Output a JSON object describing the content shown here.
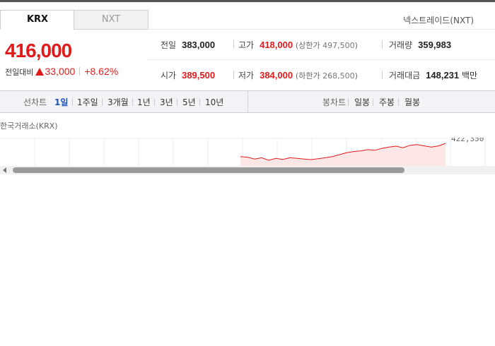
{
  "market_tabs": {
    "active": "KRX",
    "inactive": "NXT"
  },
  "nxt_link": "넥스트레이드(NXT)",
  "quote": {
    "price": "416,000",
    "change_label": "전일대비",
    "change_amount": "33,000",
    "change_percent": "+8.62%",
    "color_up": "#e01b1b"
  },
  "stats": {
    "prev_close": {
      "label": "전일",
      "value": "383,000"
    },
    "high": {
      "label": "고가",
      "value": "418,000",
      "upper_limit_label": "상한가",
      "upper_limit_value": "497,500"
    },
    "volume": {
      "label": "거래량",
      "value": "359,983"
    },
    "open": {
      "label": "시가",
      "value": "389,500"
    },
    "low": {
      "label": "저가",
      "value": "384,000",
      "lower_limit_label": "하한가",
      "lower_limit_value": "268,500"
    },
    "trade_value": {
      "label": "거래대금",
      "value": "148,231",
      "unit": "백만"
    }
  },
  "chart_toolbar": {
    "line_label": "선차트",
    "periods": [
      "1일",
      "1주일",
      "3개월",
      "1년",
      "3년",
      "5년",
      "10년"
    ],
    "active_period": "1일",
    "candle_label": "봉차트",
    "candle_periods": [
      "일봉",
      "주봉",
      "월봉"
    ]
  },
  "exchange_label": "한국거래소(KRX)",
  "chart_data": {
    "type": "line",
    "title": "",
    "xlabel": "",
    "ylabel": "",
    "y_tick_labels": [
      "422,350"
    ],
    "grid": true,
    "series": [
      {
        "values": [
          395000,
          394000,
          391000,
          393000,
          389000,
          392000,
          390500,
          393000,
          392000,
          391000,
          390000,
          391500,
          393000,
          395000,
          398000,
          401000,
          403000,
          404000,
          406000,
          405000,
          408000,
          410000,
          411500,
          409000,
          413000,
          414000,
          412000,
          410000,
          412000,
          416000
        ]
      }
    ]
  }
}
